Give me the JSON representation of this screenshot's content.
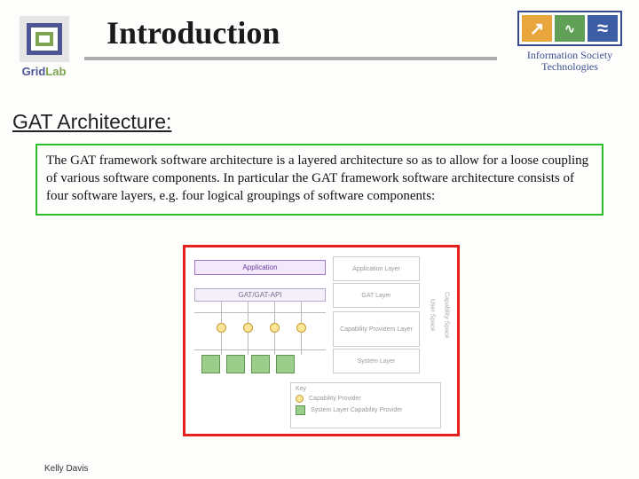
{
  "header": {
    "title": "Introduction",
    "gridlab_text_1": "Grid",
    "gridlab_text_2": "Lab",
    "ist_arrow": "↗",
    "ist_wave": "∿",
    "ist_approx": "≈",
    "ist_line1": "Information Society",
    "ist_line2": "Technologies"
  },
  "subtitle": "GAT Architecture:",
  "body_text": "The GAT framework software architecture  is a layered architecture so as to allow for a loose coupling of various software components. In particular the GAT framework software architecture consists of four software layers, e.g. four logical groupings of software components:",
  "diagram": {
    "application": "Application",
    "gat_api": "GAT/GAT-API",
    "layer_app": "Application Layer",
    "layer_gat": "GAT Layer",
    "layer_cap": "Capability Providers Layer",
    "layer_sys": "System Layer",
    "side_user": "User Space",
    "side_cap": "Capability Space",
    "key_title": "Key",
    "key_cap": "Capability Provider",
    "key_sys": "System Layer Capability Provider"
  },
  "footer": "Kelly Davis"
}
